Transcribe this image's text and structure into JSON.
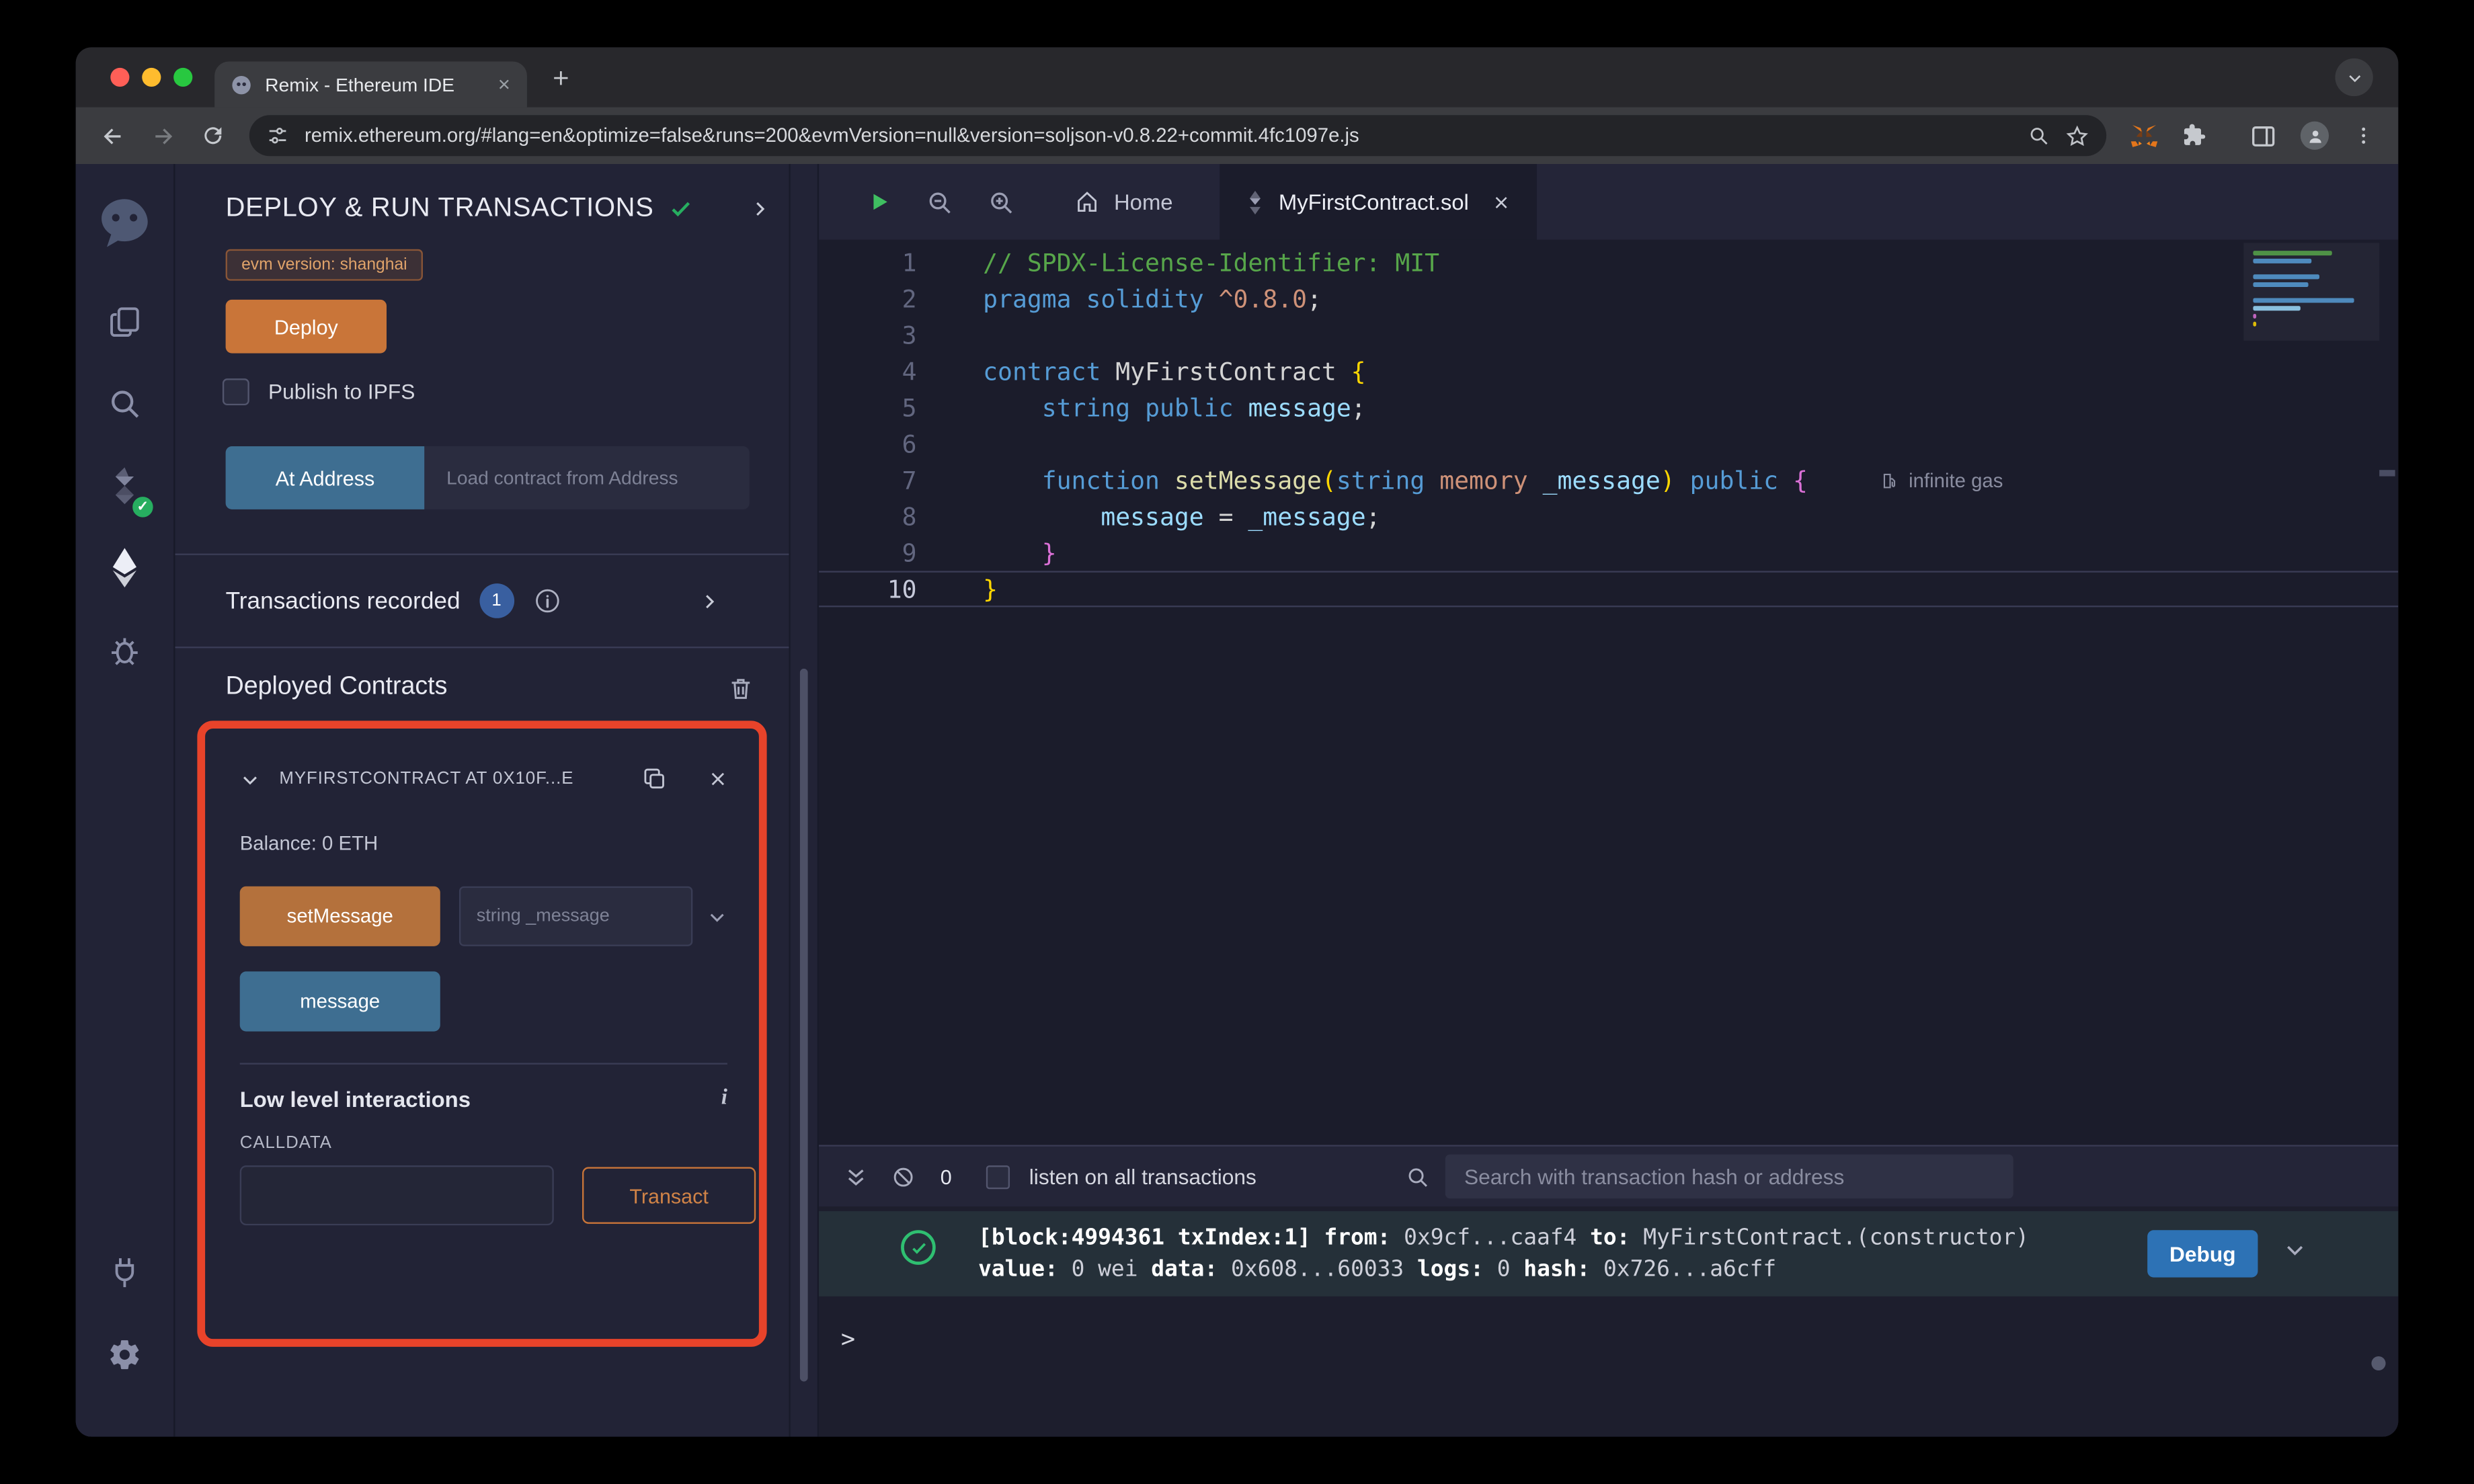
{
  "browser": {
    "tab_title": "Remix - Ethereum IDE",
    "url": "remix.ethereum.org/#lang=en&optimize=false&runs=200&evmVersion=null&version=soljson-v0.8.22+commit.4fc1097e.js"
  },
  "panel": {
    "title": "DEPLOY & RUN TRANSACTIONS",
    "evm_badge": "evm version: shanghai",
    "deploy_button": "Deploy",
    "publish_checkbox": "Publish to IPFS",
    "at_address_button": "At Address",
    "at_address_placeholder": "Load contract from Address",
    "transactions_recorded": "Transactions recorded",
    "transactions_badge": "1",
    "deployed_contracts": "Deployed Contracts",
    "contract": {
      "title": "MYFIRSTCONTRACT AT 0X10F...E",
      "balance": "Balance: 0 ETH",
      "set_message_button": "setMessage",
      "set_message_placeholder": "string _message",
      "message_button": "message",
      "low_level_title": "Low level interactions",
      "calldata_label": "CALLDATA",
      "transact_button": "Transact"
    }
  },
  "editor": {
    "home_tab": "Home",
    "file_tab": "MyFirstContract.sol",
    "gas_annotation": "infinite gas",
    "lines": [
      {
        "num": "1",
        "tokens": [
          {
            "t": "// SPDX-License-Identifier: MIT",
            "c": "comment"
          }
        ]
      },
      {
        "num": "2",
        "tokens": [
          {
            "t": "pragma",
            "c": "kw"
          },
          {
            "t": " "
          },
          {
            "t": "solidity",
            "c": "kw"
          },
          {
            "t": " "
          },
          {
            "t": "^0.8.0",
            "c": "str"
          },
          {
            "t": ";"
          }
        ]
      },
      {
        "num": "3",
        "tokens": []
      },
      {
        "num": "4",
        "tokens": [
          {
            "t": "contract",
            "c": "kw"
          },
          {
            "t": " MyFirstContract "
          },
          {
            "t": "{",
            "c": "br1"
          }
        ]
      },
      {
        "num": "5",
        "tokens": [
          {
            "t": "    "
          },
          {
            "t": "string",
            "c": "kw"
          },
          {
            "t": " "
          },
          {
            "t": "public",
            "c": "kw"
          },
          {
            "t": " "
          },
          {
            "t": "message",
            "c": "var"
          },
          {
            "t": ";"
          }
        ]
      },
      {
        "num": "6",
        "tokens": []
      },
      {
        "num": "7",
        "gas": true,
        "tokens": [
          {
            "t": "    "
          },
          {
            "t": "function",
            "c": "kw"
          },
          {
            "t": " "
          },
          {
            "t": "setMessage",
            "c": "fn"
          },
          {
            "t": "(",
            "c": "br1"
          },
          {
            "t": "string",
            "c": "kw"
          },
          {
            "t": " "
          },
          {
            "t": "memory",
            "c": "str"
          },
          {
            "t": " "
          },
          {
            "t": "_message",
            "c": "var"
          },
          {
            "t": ")",
            "c": "br1"
          },
          {
            "t": " "
          },
          {
            "t": "public",
            "c": "kw"
          },
          {
            "t": " "
          },
          {
            "t": "{",
            "c": "br2"
          }
        ]
      },
      {
        "num": "8",
        "tokens": [
          {
            "t": "        "
          },
          {
            "t": "message",
            "c": "var"
          },
          {
            "t": " = "
          },
          {
            "t": "_message",
            "c": "var"
          },
          {
            "t": ";"
          }
        ]
      },
      {
        "num": "9",
        "tokens": [
          {
            "t": "    "
          },
          {
            "t": "}",
            "c": "br2"
          }
        ]
      },
      {
        "num": "10",
        "active": true,
        "tokens": [
          {
            "t": "}",
            "c": "br1"
          }
        ]
      }
    ]
  },
  "terminal": {
    "pending_count": "0",
    "listen_label": "listen on all transactions",
    "search_placeholder": "Search with transaction hash or address",
    "debug_button": "Debug",
    "prompt": ">",
    "log_line1": [
      {
        "t": "[block:4994361 txIndex:1]",
        "c": "b"
      },
      {
        "t": " "
      },
      {
        "t": "from:",
        "c": "b"
      },
      {
        "t": " 0x9cf...caaf4 "
      },
      {
        "t": "to:",
        "c": "b"
      },
      {
        "t": " MyFirstContract.(constructor) "
      }
    ],
    "log_line2": [
      {
        "t": "value:",
        "c": "b"
      },
      {
        "t": " 0 wei "
      },
      {
        "t": "data:",
        "c": "b"
      },
      {
        "t": " 0x608...60033 "
      },
      {
        "t": "logs:",
        "c": "b"
      },
      {
        "t": " 0 "
      },
      {
        "t": "hash:",
        "c": "b"
      },
      {
        "t": " 0x726...a6cff"
      }
    ]
  },
  "icons": {
    "info_italic": "i",
    "names": [
      "remix-logo",
      "file-explorer-icon",
      "search-icon",
      "solidity-compiler-icon",
      "deploy-run-icon",
      "debugger-icon",
      "plugin-manager-icon",
      "settings-gear-icon",
      "play-icon",
      "zoom-out-icon",
      "zoom-in-icon",
      "home-icon",
      "solidity-file-icon",
      "close-icon",
      "copy-icon",
      "trash-icon",
      "info-icon",
      "check-icon",
      "chevron-down-icon",
      "chevron-right-icon",
      "metamask-fox-icon",
      "extensions-puzzle-icon",
      "profile-icon",
      "menu-dots-icon",
      "bookmark-star-icon",
      "reload-icon",
      "back-icon",
      "forward-icon",
      "search-magnifier-icon",
      "ban-icon",
      "collapse-icon",
      "success-check-icon",
      "gas-icon"
    ]
  },
  "colors": {
    "accent_orange": "#c97539",
    "accent_blue": "#3e6e91",
    "debug_blue": "#2d72b5",
    "annotation_red": "#e8432a",
    "success_green": "#27ae60",
    "panel_bg": "#222336",
    "editor_bg": "#1b1c2b"
  }
}
